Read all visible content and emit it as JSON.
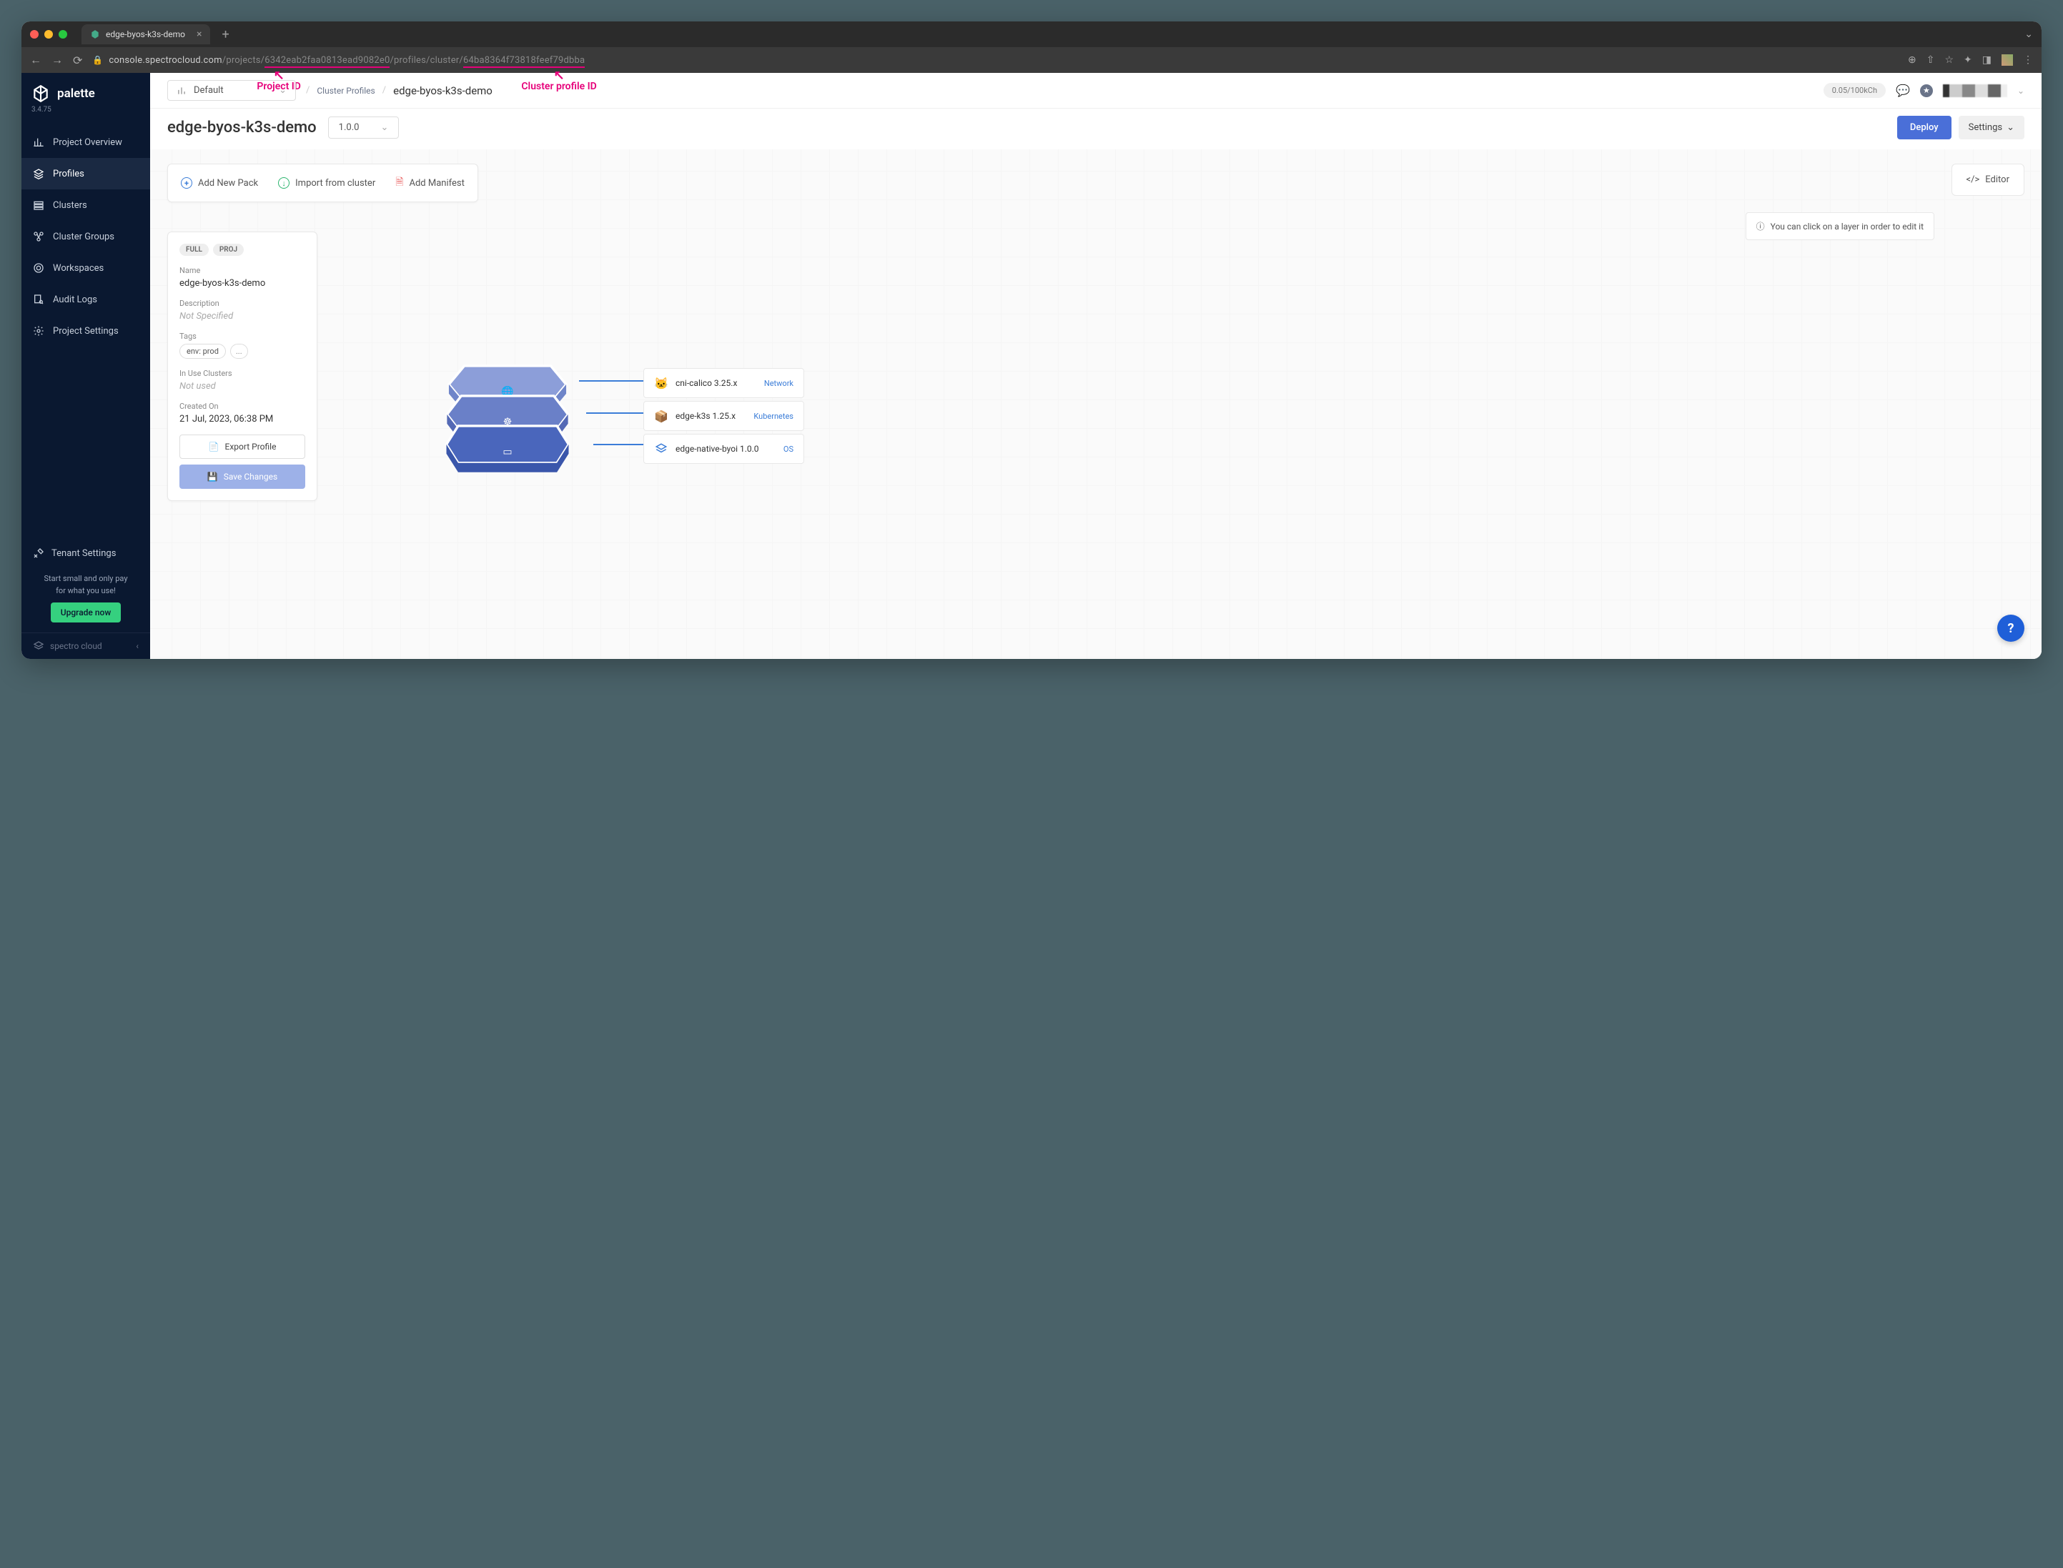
{
  "browser": {
    "tab_title": "edge-byos-k3s-demo",
    "url_host": "console.spectrocloud.com",
    "url_p1": "/projects/",
    "url_pid": "6342eab2faa0813ead9082e0",
    "url_p2": "/profiles/cluster/",
    "url_cid": "64ba8364f73818feef79dbba"
  },
  "annotations": {
    "project_id": "Project ID",
    "cluster_profile_id": "Cluster profile ID"
  },
  "sidebar": {
    "brand": "palette",
    "version": "3.4.75",
    "items": [
      {
        "label": "Project Overview"
      },
      {
        "label": "Profiles"
      },
      {
        "label": "Clusters"
      },
      {
        "label": "Cluster Groups"
      },
      {
        "label": "Workspaces"
      },
      {
        "label": "Audit Logs"
      },
      {
        "label": "Project Settings"
      }
    ],
    "tenant": "Tenant Settings",
    "promo1": "Start small and only pay",
    "promo2": "for what you use!",
    "upgrade": "Upgrade now",
    "footer": "spectro cloud"
  },
  "topbar": {
    "project": "Default",
    "bc_parent": "Cluster Profiles",
    "bc_current": "edge-byos-k3s-demo",
    "credits": "0.05/100kCh"
  },
  "header": {
    "title": "edge-byos-k3s-demo",
    "version": "1.0.0",
    "deploy": "Deploy",
    "settings": "Settings"
  },
  "toolbar": {
    "add": "Add New Pack",
    "import": "Import from cluster",
    "manifest": "Add Manifest",
    "editor": "Editor"
  },
  "hint": "You can click on a layer in order to edit it",
  "details": {
    "badge1": "FULL",
    "badge2": "PROJ",
    "name_lbl": "Name",
    "name": "edge-byos-k3s-demo",
    "desc_lbl": "Description",
    "desc": "Not Specified",
    "tags_lbl": "Tags",
    "tag1": "env: prod",
    "tag_more": "...",
    "inuse_lbl": "In Use Clusters",
    "inuse": "Not used",
    "created_lbl": "Created On",
    "created": "21 Jul, 2023, 06:38 PM",
    "export": "Export Profile",
    "save": "Save Changes"
  },
  "layers": [
    {
      "name": "cni-calico 3.25.x",
      "type": "Network"
    },
    {
      "name": "edge-k3s 1.25.x",
      "type": "Kubernetes"
    },
    {
      "name": "edge-native-byoi 1.0.0",
      "type": "OS"
    }
  ],
  "fab": "?"
}
